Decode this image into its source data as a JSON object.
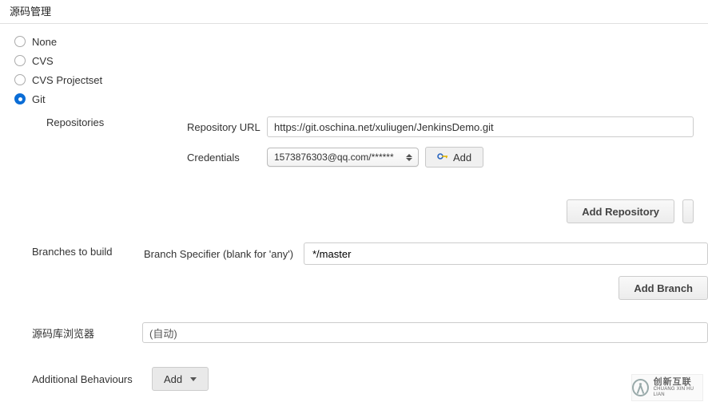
{
  "section_title": "源码管理",
  "scm": {
    "options": [
      {
        "label": "None",
        "selected": false
      },
      {
        "label": "CVS",
        "selected": false
      },
      {
        "label": "CVS Projectset",
        "selected": false
      },
      {
        "label": "Git",
        "selected": true
      }
    ]
  },
  "git": {
    "repositories_label": "Repositories",
    "repository_url_label": "Repository URL",
    "repository_url_value": "https://git.oschina.net/xuliugen/JenkinsDemo.git",
    "credentials_label": "Credentials",
    "credentials_selected": "1573876303@qq.com/******",
    "add_credential_label": "Add",
    "add_repository_label": "Add Repository",
    "branches_label": "Branches to build",
    "branch_specifier_label": "Branch Specifier (blank for 'any')",
    "branch_specifier_value": "*/master",
    "add_branch_label": "Add Branch",
    "browser_label": "源码库浏览器",
    "browser_selected": "(自动)",
    "behaviours_label": "Additional Behaviours",
    "behaviours_add_label": "Add"
  },
  "logo": {
    "line1": "创新互联",
    "line2": "CHUANG XIN HU LIAN"
  }
}
